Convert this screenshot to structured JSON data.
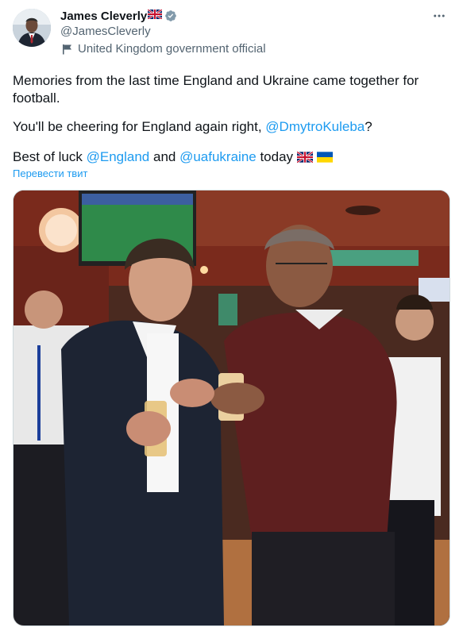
{
  "author": {
    "name": "James Cleverly",
    "handle": "@JamesCleverly",
    "affiliation": "United Kingdom government official"
  },
  "tweet": {
    "line1": "Memories from the last time England and Ukraine came together for football.",
    "line2_prefix": "You'll be cheering for England again right, ",
    "line2_mention": "@DmytroKuleba",
    "line2_suffix": "?",
    "line3_prefix": "Best of luck ",
    "line3_mention1": "@England",
    "line3_mid": " and ",
    "line3_mention2": "@uafukraine",
    "line3_suffix": " today",
    "translate_label": "Перевести твит"
  },
  "icons": {
    "more": "more-options-icon",
    "verified": "verified-badge-icon",
    "affiliation": "government-flag-icon"
  },
  "colors": {
    "link": "#1d9bf0",
    "secondary_text": "#536471",
    "verified_gray": "#829aab"
  }
}
